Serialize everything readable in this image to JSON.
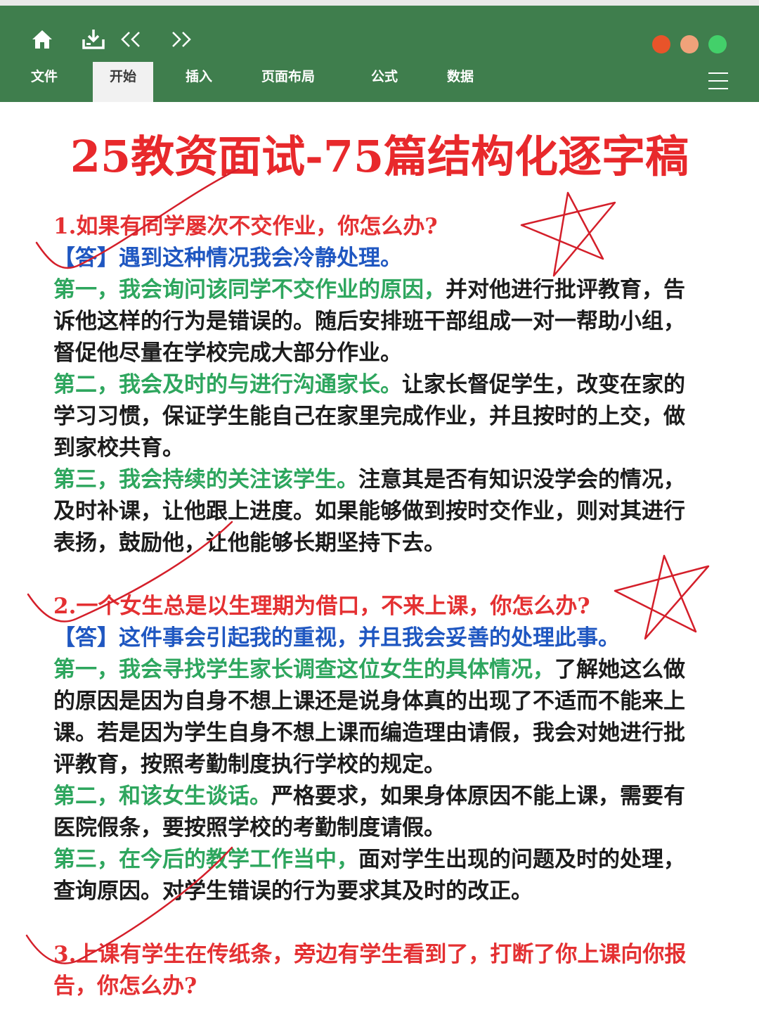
{
  "toolbar": {
    "icons": [
      "home-icon",
      "download-icon",
      "prev-icon",
      "next-icon"
    ],
    "window_dots": [
      "#e8542a",
      "#f0a27a",
      "#43d06a"
    ]
  },
  "tabs": [
    "文件",
    "开始",
    "插入",
    "页面布局",
    "公式",
    "数据"
  ],
  "active_tab": "开始",
  "colors": {
    "ribbon": "#3f7e4d",
    "title": "#e8292c",
    "question": "#e43032",
    "answer": "#1f57c1",
    "lead": "#2ea65e",
    "annotation": "#d41f2a"
  },
  "title": "25教资面试-75篇结构化逐字稿",
  "q1": {
    "question": "1.如果有同学屡次不交作业，你怎么办?",
    "answer": "【答】遇到这种情况我会冷静处理。",
    "p1_lead": "第一，我会询问该同学不交作业的原因，",
    "p1_text": "并对他进行批评教育，告诉他这样的行为是错误的。随后安排班干部组成一对一帮助小组，督促他尽量在学校完成大部分作业。",
    "p2_lead": "第二，我会及时的与进行沟通家长。",
    "p2_text": "让家长督促学生，改变在家的学习习惯，保证学生能自己在家里完成作业，并且按时的上交，做到家校共育。",
    "p3_lead": "第三，我会持续的关注该学生。",
    "p3_text": "注意其是否有知识没学会的情况，及时补课，让他跟上进度。如果能够做到按时交作业，则对其进行表扬，鼓励他，让他能够长期坚持下去。"
  },
  "q2": {
    "question": "2.一个女生总是以生理期为借口，不来上课，你怎么办?",
    "answer": "【答】这件事会引起我的重视，并且我会妥善的处理此事。",
    "p1_lead": "第一，我会寻找学生家长调查这位女生的具体情况，",
    "p1_text": "了解她这么做的原因是因为自身不想上课还是说身体真的出现了不适而不能来上课。若是因为学生自身不想上课而编造理由请假，我会对她进行批评教育，按照考勤制度执行学校的规定。",
    "p2_lead": "第二，和该女生谈话。",
    "p2_text": "严格要求，如果身体原因不能上课，需要有医院假条，要按照学校的考勤制度请假。",
    "p3_lead": "第三，在今后的教学工作当中，",
    "p3_text": "面对学生出现的问题及时的处理，查询原因。对学生错误的行为要求其及时的改正。"
  },
  "q3": {
    "question": "3.上课有学生在传纸条，旁边有学生看到了，打断了你上课向你报告，你怎么办?"
  }
}
